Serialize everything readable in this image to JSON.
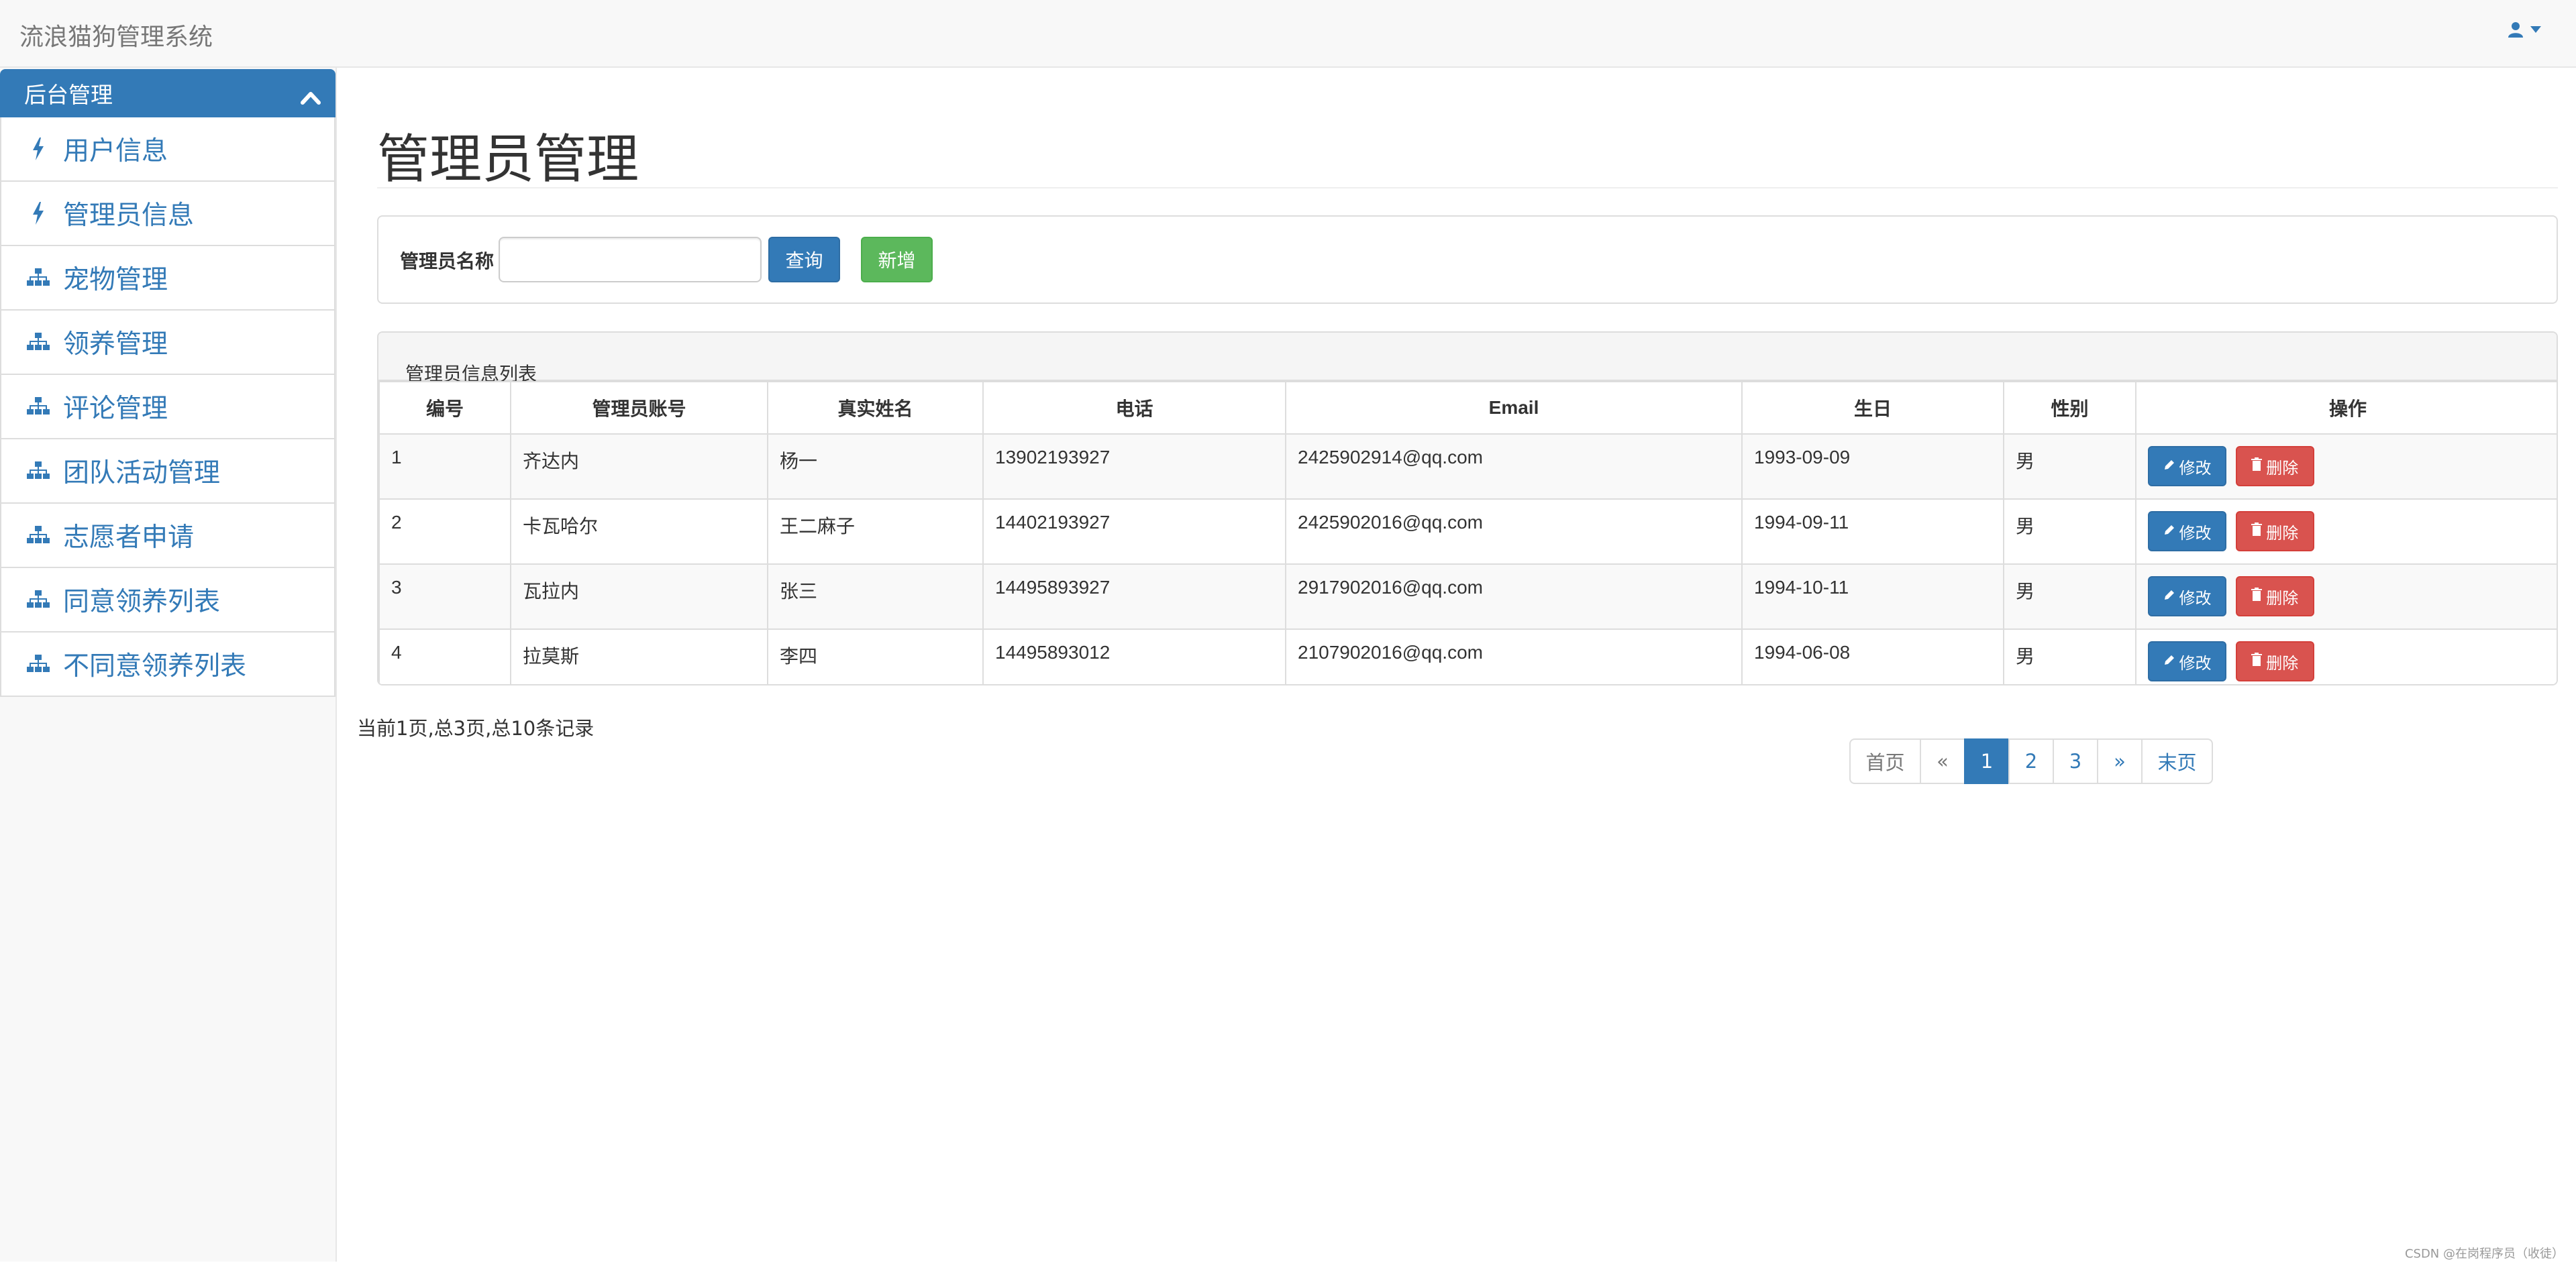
{
  "app": {
    "title": "流浪猫狗管理系统"
  },
  "navbar": {
    "user_icon": "user-icon",
    "caret_icon": "caret-down-icon"
  },
  "sidebar": {
    "heading": "后台管理",
    "items": [
      {
        "label": "用户信息",
        "icon": "bolt-icon"
      },
      {
        "label": "管理员信息",
        "icon": "bolt-icon"
      },
      {
        "label": "宠物管理",
        "icon": "sitemap-icon"
      },
      {
        "label": "领养管理",
        "icon": "sitemap-icon"
      },
      {
        "label": "评论管理",
        "icon": "sitemap-icon"
      },
      {
        "label": "团队活动管理",
        "icon": "sitemap-icon"
      },
      {
        "label": "志愿者申请",
        "icon": "sitemap-icon"
      },
      {
        "label": "同意领养列表",
        "icon": "sitemap-icon"
      },
      {
        "label": "不同意领养列表",
        "icon": "sitemap-icon"
      }
    ]
  },
  "page": {
    "title": "管理员管理"
  },
  "search": {
    "label": "管理员名称",
    "value": "",
    "query_button": "查询",
    "add_button": "新增"
  },
  "table": {
    "caption": "管理员信息列表",
    "columns": [
      "编号",
      "管理员账号",
      "真实姓名",
      "电话",
      "Email",
      "生日",
      "性别",
      "操作"
    ],
    "rows": [
      {
        "id": "1",
        "account": "齐达内",
        "name": "杨一",
        "phone": "13902193927",
        "email": "2425902914@qq.com",
        "birthday": "1993-09-09",
        "gender": "男"
      },
      {
        "id": "2",
        "account": "卡瓦哈尔",
        "name": "王二麻子",
        "phone": "14402193927",
        "email": "2425902016@qq.com",
        "birthday": "1994-09-11",
        "gender": "男"
      },
      {
        "id": "3",
        "account": "瓦拉内",
        "name": "张三",
        "phone": "14495893927",
        "email": "2917902016@qq.com",
        "birthday": "1994-10-11",
        "gender": "男"
      },
      {
        "id": "4",
        "account": "拉莫斯",
        "name": "李四",
        "phone": "14495893012",
        "email": "2107902016@qq.com",
        "birthday": "1994-06-08",
        "gender": "男"
      }
    ],
    "edit_label": "修改",
    "delete_label": "删除"
  },
  "pager": {
    "info": "当前1页,总3页,总10条记录",
    "first": "首页",
    "prev": "«",
    "pages": [
      "1",
      "2",
      "3"
    ],
    "current": "1",
    "next": "»",
    "last": "末页"
  },
  "watermark": "CSDN @在岗程序员（收徒）",
  "colors": {
    "primary": "#337ab7",
    "success": "#5cb85c",
    "danger": "#d9534f"
  }
}
